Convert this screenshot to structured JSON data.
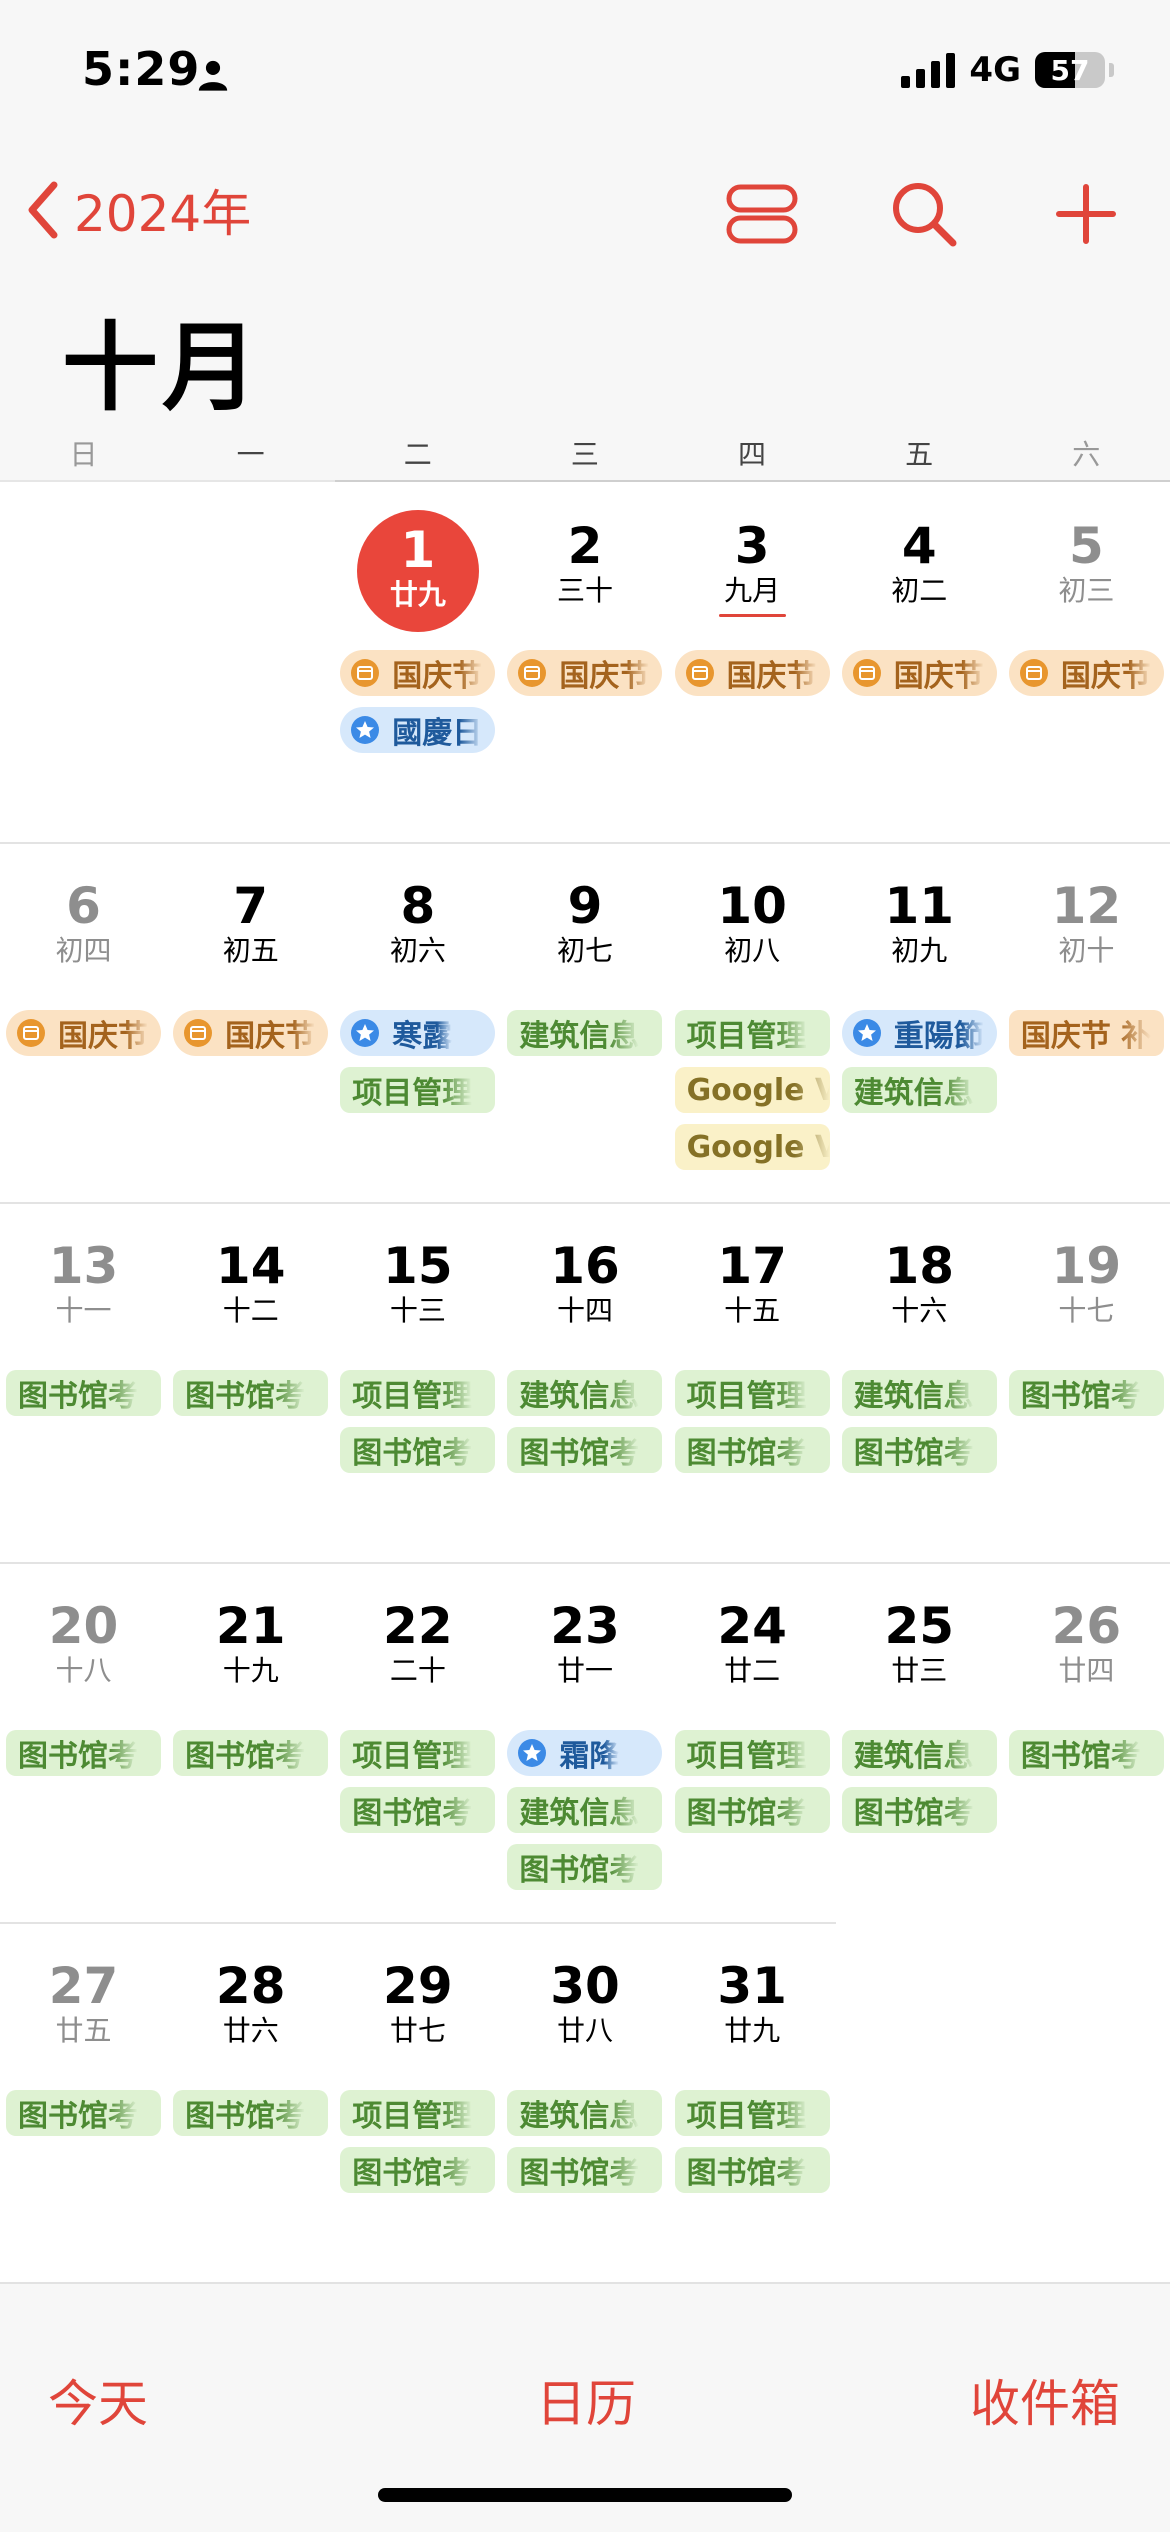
{
  "status_bar": {
    "time": "5:29",
    "network": "4G",
    "battery": "57",
    "battery_level": 0.57
  },
  "nav": {
    "back_label": "2024年",
    "month_title": "十月",
    "accent_color": "#e0453a"
  },
  "weekdays": [
    "日",
    "一",
    "二",
    "三",
    "四",
    "五",
    "六"
  ],
  "weeks": [
    [
      null,
      null,
      {
        "num": "1",
        "lunar": "廿九",
        "today": true,
        "events": [
          {
            "type": "holiday",
            "icon": "calendar-icon",
            "label": "国庆节"
          },
          {
            "type": "festival",
            "icon": "star-icon",
            "label": "國慶日"
          }
        ]
      },
      {
        "num": "2",
        "lunar": "三十",
        "events": [
          {
            "type": "holiday",
            "icon": "calendar-icon",
            "label": "国庆节"
          }
        ]
      },
      {
        "num": "3",
        "lunar": "九月",
        "lunar_underline": true,
        "events": [
          {
            "type": "holiday",
            "icon": "calendar-icon",
            "label": "国庆节"
          }
        ]
      },
      {
        "num": "4",
        "lunar": "初二",
        "events": [
          {
            "type": "holiday",
            "icon": "calendar-icon",
            "label": "国庆节"
          }
        ]
      },
      {
        "num": "5",
        "lunar": "初三",
        "events": [
          {
            "type": "holiday",
            "icon": "calendar-icon",
            "label": "国庆节"
          }
        ]
      }
    ],
    [
      {
        "num": "6",
        "lunar": "初四",
        "events": [
          {
            "type": "holiday",
            "icon": "calendar-icon",
            "label": "国庆节"
          }
        ]
      },
      {
        "num": "7",
        "lunar": "初五",
        "events": [
          {
            "type": "holiday",
            "icon": "calendar-icon",
            "label": "国庆节"
          }
        ]
      },
      {
        "num": "8",
        "lunar": "初六",
        "events": [
          {
            "type": "festival",
            "icon": "star-icon",
            "label": "寒露"
          },
          {
            "type": "green",
            "label": "项目管理"
          }
        ]
      },
      {
        "num": "9",
        "lunar": "初七",
        "events": [
          {
            "type": "green",
            "label": "建筑信息"
          }
        ]
      },
      {
        "num": "10",
        "lunar": "初八",
        "events": [
          {
            "type": "green",
            "label": "项目管理"
          },
          {
            "type": "google",
            "label": "Google V"
          },
          {
            "type": "google",
            "label": "Google V"
          }
        ]
      },
      {
        "num": "11",
        "lunar": "初九",
        "events": [
          {
            "type": "festival",
            "icon": "star-icon",
            "label": "重陽節"
          },
          {
            "type": "green",
            "label": "建筑信息"
          }
        ]
      },
      {
        "num": "12",
        "lunar": "初十",
        "events": [
          {
            "type": "peach",
            "label": "国庆节 补"
          }
        ]
      }
    ],
    [
      {
        "num": "13",
        "lunar": "十一",
        "events": [
          {
            "type": "green",
            "label": "图书馆考"
          }
        ]
      },
      {
        "num": "14",
        "lunar": "十二",
        "events": [
          {
            "type": "green",
            "label": "图书馆考"
          }
        ]
      },
      {
        "num": "15",
        "lunar": "十三",
        "events": [
          {
            "type": "green",
            "label": "项目管理"
          },
          {
            "type": "green",
            "label": "图书馆考"
          }
        ]
      },
      {
        "num": "16",
        "lunar": "十四",
        "events": [
          {
            "type": "green",
            "label": "建筑信息"
          },
          {
            "type": "green",
            "label": "图书馆考"
          }
        ]
      },
      {
        "num": "17",
        "lunar": "十五",
        "events": [
          {
            "type": "green",
            "label": "项目管理"
          },
          {
            "type": "green",
            "label": "图书馆考"
          }
        ]
      },
      {
        "num": "18",
        "lunar": "十六",
        "events": [
          {
            "type": "green",
            "label": "建筑信息"
          },
          {
            "type": "green",
            "label": "图书馆考"
          }
        ]
      },
      {
        "num": "19",
        "lunar": "十七",
        "events": [
          {
            "type": "green",
            "label": "图书馆考"
          }
        ]
      }
    ],
    [
      {
        "num": "20",
        "lunar": "十八",
        "events": [
          {
            "type": "green",
            "label": "图书馆考"
          }
        ]
      },
      {
        "num": "21",
        "lunar": "十九",
        "events": [
          {
            "type": "green",
            "label": "图书馆考"
          }
        ]
      },
      {
        "num": "22",
        "lunar": "二十",
        "events": [
          {
            "type": "green",
            "label": "项目管理"
          },
          {
            "type": "green",
            "label": "图书馆考"
          }
        ]
      },
      {
        "num": "23",
        "lunar": "廿一",
        "events": [
          {
            "type": "festival",
            "icon": "star-icon",
            "label": "霜降"
          },
          {
            "type": "green",
            "label": "建筑信息"
          },
          {
            "type": "green",
            "label": "图书馆考"
          }
        ]
      },
      {
        "num": "24",
        "lunar": "廿二",
        "events": [
          {
            "type": "green",
            "label": "项目管理"
          },
          {
            "type": "green",
            "label": "图书馆考"
          }
        ]
      },
      {
        "num": "25",
        "lunar": "廿三",
        "events": [
          {
            "type": "green",
            "label": "建筑信息"
          },
          {
            "type": "green",
            "label": "图书馆考"
          }
        ]
      },
      {
        "num": "26",
        "lunar": "廿四",
        "events": [
          {
            "type": "green",
            "label": "图书馆考"
          }
        ]
      }
    ],
    [
      {
        "num": "27",
        "lunar": "廿五",
        "events": [
          {
            "type": "green",
            "label": "图书馆考"
          }
        ]
      },
      {
        "num": "28",
        "lunar": "廿六",
        "events": [
          {
            "type": "green",
            "label": "图书馆考"
          }
        ]
      },
      {
        "num": "29",
        "lunar": "廿七",
        "events": [
          {
            "type": "green",
            "label": "项目管理"
          },
          {
            "type": "green",
            "label": "图书馆考"
          }
        ]
      },
      {
        "num": "30",
        "lunar": "廿八",
        "events": [
          {
            "type": "green",
            "label": "建筑信息"
          },
          {
            "type": "green",
            "label": "图书馆考"
          }
        ]
      },
      {
        "num": "31",
        "lunar": "廿九",
        "events": [
          {
            "type": "green",
            "label": "项目管理"
          },
          {
            "type": "green",
            "label": "图书馆考"
          }
        ]
      },
      null,
      null
    ]
  ],
  "tab_bar": {
    "today": "今天",
    "calendars": "日历",
    "inbox": "收件箱"
  }
}
